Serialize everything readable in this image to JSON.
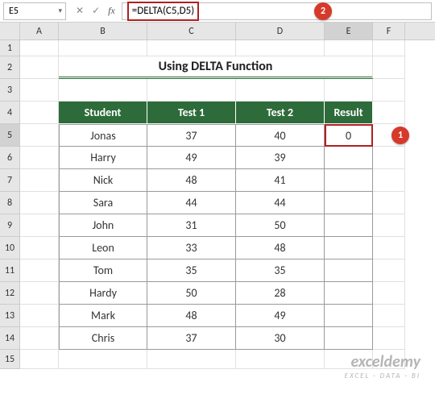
{
  "name_box": "E5",
  "formula": "=DELTA(C5,D5)",
  "columns": [
    "",
    "A",
    "B",
    "C",
    "D",
    "E",
    "F"
  ],
  "title": "Using DELTA Function",
  "headers": {
    "student": "Student",
    "test1": "Test 1",
    "test2": "Test 2",
    "result": "Result"
  },
  "rows": [
    {
      "n": "1"
    },
    {
      "n": "2"
    },
    {
      "n": "3"
    },
    {
      "n": "4"
    },
    {
      "n": "5",
      "student": "Jonas",
      "t1": "37",
      "t2": "40",
      "res": "0"
    },
    {
      "n": "6",
      "student": "Harry",
      "t1": "49",
      "t2": "39",
      "res": ""
    },
    {
      "n": "7",
      "student": "Nick",
      "t1": "48",
      "t2": "41",
      "res": ""
    },
    {
      "n": "8",
      "student": "Sara",
      "t1": "44",
      "t2": "44",
      "res": ""
    },
    {
      "n": "9",
      "student": "John",
      "t1": "31",
      "t2": "50",
      "res": ""
    },
    {
      "n": "10",
      "student": "Leon",
      "t1": "33",
      "t2": "48",
      "res": ""
    },
    {
      "n": "11",
      "student": "Tom",
      "t1": "35",
      "t2": "35",
      "res": ""
    },
    {
      "n": "12",
      "student": "Hardy",
      "t1": "50",
      "t2": "28",
      "res": ""
    },
    {
      "n": "13",
      "student": "Mark",
      "t1": "48",
      "t2": "49",
      "res": ""
    },
    {
      "n": "14",
      "student": "Chris",
      "t1": "37",
      "t2": "30",
      "res": ""
    },
    {
      "n": "15"
    }
  ],
  "callouts": {
    "one": "1",
    "two": "2"
  },
  "watermark": {
    "line1": "exceldemy",
    "line2": "EXCEL · DATA · BI"
  },
  "icons": {
    "dropdown": "▾",
    "cancel": "✕",
    "accept": "✓",
    "fx": "fx"
  }
}
